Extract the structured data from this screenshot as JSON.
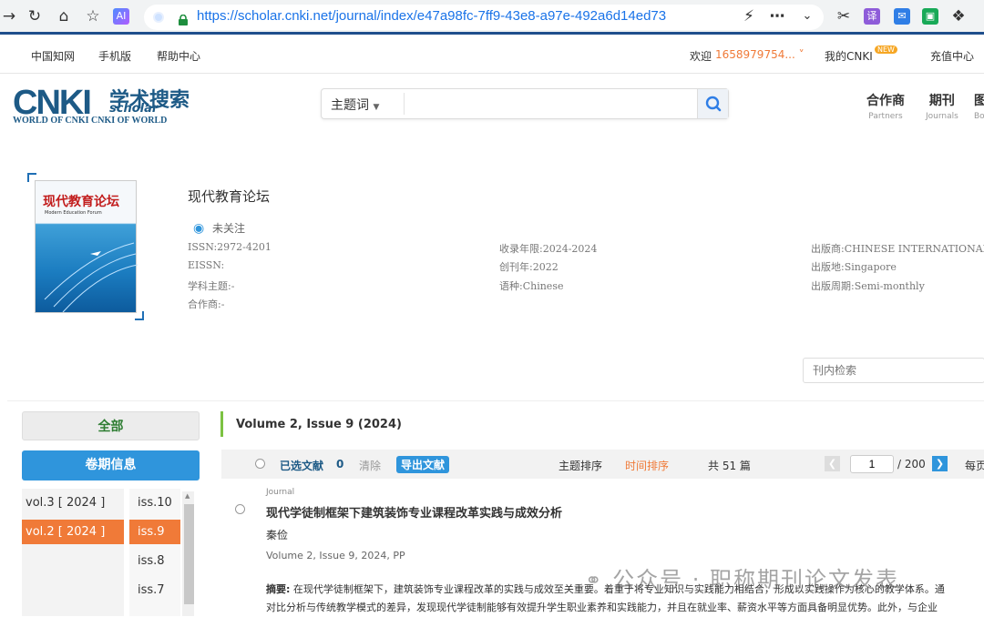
{
  "browser": {
    "url": "https://scholar.cnki.net/journal/index/e47a98fc-7ff9-43e8-a97e-492a6d14ed73",
    "ext_ai_label": "AI",
    "ext_translate_label": "译"
  },
  "topbar": {
    "home": "中国知网",
    "mobile": "手机版",
    "help": "帮助中心",
    "welcome": "欢迎",
    "user": "1658979754...",
    "my_cnki": "我的CNKI",
    "new_badge": "NEW",
    "recharge": "充值中心"
  },
  "header": {
    "logo_main": "CNKI",
    "logo_cn": "学术搜索",
    "logo_scholar": "scholar",
    "logo_sub": "WORLD OF CNKI CNKI OF WORLD",
    "search_field": "主题词",
    "search_placeholder": "",
    "nav": [
      {
        "label": "合作商",
        "sub": "Partners"
      },
      {
        "label": "期刊",
        "sub": "Journals"
      },
      {
        "label": "图",
        "sub": "Bo"
      }
    ]
  },
  "journal": {
    "title": "现代教育论坛",
    "cover_title": "现代教育论坛",
    "cover_en": "Modern Education Forum",
    "follow": "未关注",
    "issn": "ISSN:2972-4201",
    "eissn": "EISSN:",
    "subject": "学科主题:-",
    "partner": "合作商:-",
    "years": "收录年限:2024-2024",
    "founded": "创刊年:2022",
    "language": "语种:Chinese",
    "publisher": "出版商:CHINESE INTERNATIONAL PUBL",
    "place": "出版地:Singapore",
    "frequency": "出版周期:Semi-monthly",
    "inner_search_placeholder": "刊内检索"
  },
  "sidebar": {
    "all_label": "全部",
    "issue_info_label": "卷期信息",
    "volumes": [
      "vol.3 [ 2024 ]",
      "vol.2 [ 2024 ]"
    ],
    "issues": [
      "iss.10",
      "iss.9",
      "iss.8",
      "iss.7"
    ]
  },
  "content": {
    "volume_title": "Volume 2, Issue 9 (2024)",
    "toolbar": {
      "selected": "已选文献",
      "count": "0",
      "clear": "清除",
      "export": "导出文献",
      "sort_subject": "主题排序",
      "sort_time": "时间排序",
      "total": "共 51 篇",
      "page": "1",
      "total_pages": "/ 200",
      "per_page": "每页"
    },
    "article": {
      "type": "Journal",
      "title": "现代学徒制框架下建筑装饰专业课程改革实践与成效分析",
      "author": "秦俭",
      "source": "Volume 2, Issue 9, 2024, PP",
      "abstract_label": "摘要:",
      "abstract_line1": "在现代学徒制框架下，建筑装饰专业课程改革的实践与成效至关重要。着重于将专业知识与实践能力相结合，形成以实践操作为核心的教学体系。通",
      "abstract_line2": "对比分析与传统教学模式的差异，发现现代学徒制能够有效提升学生职业素养和实践能力，并且在就业率、薪资水平等方面具备明显优势。此外，与企业"
    }
  },
  "watermark": "公众号 · 职称期刊论文发表",
  "colors": {
    "brand_blue": "#1d5a86",
    "accent_blue": "#2f95dc",
    "active_orange": "#f07a38",
    "url_blue": "#1a73e8"
  }
}
